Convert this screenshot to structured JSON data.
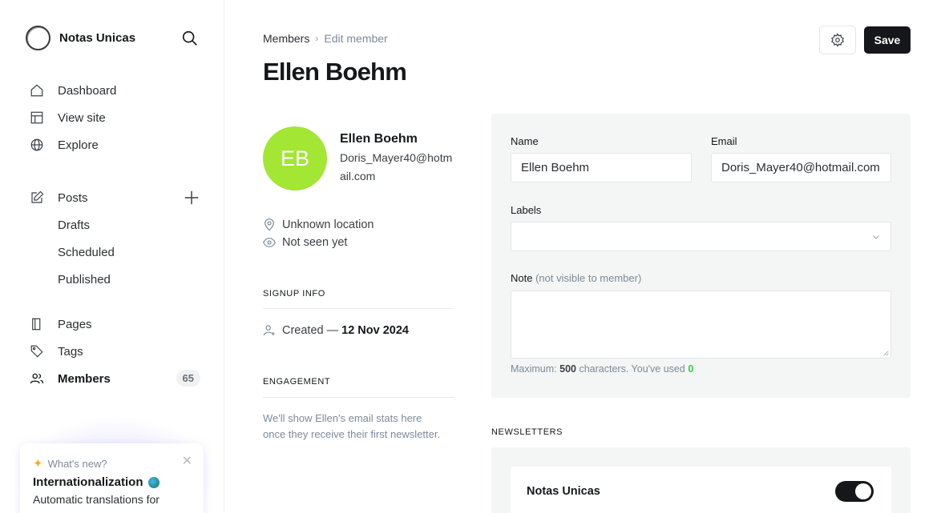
{
  "brand": {
    "name": "Notas Unicas"
  },
  "sidebar": {
    "items": [
      {
        "label": "Dashboard"
      },
      {
        "label": "View site"
      },
      {
        "label": "Explore"
      },
      {
        "label": "Posts"
      },
      {
        "label": "Drafts"
      },
      {
        "label": "Scheduled"
      },
      {
        "label": "Published"
      },
      {
        "label": "Pages"
      },
      {
        "label": "Tags"
      },
      {
        "label": "Members",
        "count": "65"
      }
    ]
  },
  "whats_new": {
    "heading": "What's new?",
    "title": "Internationalization",
    "description": "Automatic translations for"
  },
  "breadcrumb": {
    "parent": "Members",
    "current": "Edit member"
  },
  "page": {
    "title": "Ellen Boehm",
    "save_label": "Save"
  },
  "member": {
    "initials": "EB",
    "name": "Ellen Boehm",
    "email": "Doris_Mayer40@hotmail.com",
    "location": "Unknown location",
    "seen": "Not seen yet"
  },
  "signup": {
    "label": "SIGNUP INFO",
    "created_prefix": "Created —",
    "created_date": "12 Nov 2024"
  },
  "engagement": {
    "label": "ENGAGEMENT",
    "text": "We'll show Ellen's email stats here once they receive their first newsletter."
  },
  "form": {
    "name_label": "Name",
    "name_value": "Ellen Boehm",
    "email_label": "Email",
    "email_value": "Doris_Mayer40@hotmail.com",
    "labels_label": "Labels",
    "note_label": "Note",
    "note_hint": "(not visible to member)",
    "counter_prefix": "Maximum:",
    "counter_max": "500",
    "counter_middle": "characters. You've used",
    "counter_used": "0"
  },
  "newsletters": {
    "label": "NEWSLETTERS",
    "items": [
      {
        "name": "Notas Unicas",
        "subscribed": true
      }
    ]
  },
  "colors": {
    "accent": "#15171a",
    "avatar": "#a3e634",
    "used_count": "#30cf43"
  }
}
